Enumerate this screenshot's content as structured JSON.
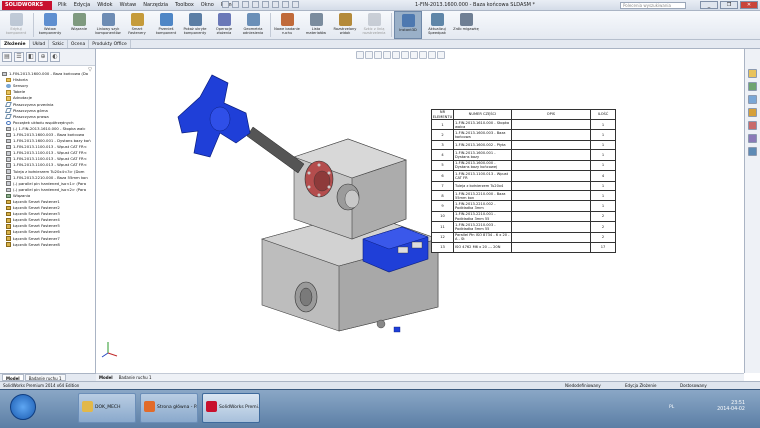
{
  "app": {
    "logo_text": "SOLIDWORKS",
    "menus": [
      "Plik",
      "Edycja",
      "Widok",
      "Wstaw",
      "Narzędzia",
      "Toolbox",
      "Okno",
      "Pomoc"
    ],
    "doc_title": "1-FIN-2013.1600.000 - Baza końcowa SLDASM *",
    "search_placeholder": "Polecenia wyszukiwania",
    "window_controls": [
      "_",
      "❐",
      "✕"
    ]
  },
  "ribbon": {
    "buttons": [
      {
        "label": "Edytuj komponent",
        "icon": "edit-component-icon",
        "color": "#8c9db3",
        "disabled": true
      },
      {
        "label": "Wstaw komponenty",
        "icon": "insert-components-icon",
        "color": "#5f8fd0",
        "disabled": false
      },
      {
        "label": "Wiązanie",
        "icon": "mate-icon",
        "color": "#7f9a7f",
        "disabled": false
      },
      {
        "label": "Liniowy szyk komponentów",
        "icon": "linear-pattern-icon",
        "color": "#6d8cb4",
        "disabled": false
      },
      {
        "label": "Smart Fastenery",
        "icon": "smart-fasteners-icon",
        "color": "#c59b3b",
        "disabled": false
      },
      {
        "label": "Przenieś komponent",
        "icon": "move-component-icon",
        "color": "#4e86c6",
        "disabled": false
      },
      {
        "label": "Pokaż ukryte komponenty",
        "icon": "show-hidden-icon",
        "color": "#5b7ea5",
        "disabled": false
      },
      {
        "label": "Operacje złożenia",
        "icon": "assembly-features-icon",
        "color": "#6a78b8",
        "disabled": false
      },
      {
        "label": "Geometria odniesienia",
        "icon": "reference-geometry-icon",
        "color": "#6a8fb8",
        "disabled": false
      },
      {
        "label": "Nowe badanie ruchu",
        "icon": "motion-study-icon",
        "color": "#c06a3a",
        "disabled": false
      },
      {
        "label": "Lista materiałów",
        "icon": "bom-icon",
        "color": "#7b8c9e",
        "disabled": false
      },
      {
        "label": "Rozstrzelony widok",
        "icon": "exploded-view-icon",
        "color": "#b48a3a",
        "disabled": false
      },
      {
        "label": "Szkic z linią rozstrzelenia",
        "icon": "explode-line-icon",
        "color": "#a0a8b3",
        "disabled": true
      },
      {
        "label": "Instant3D",
        "icon": "instant3d-icon",
        "color": "#4d78b0",
        "disabled": false,
        "active": true
      },
      {
        "label": "Aktualizuj Speedpak",
        "icon": "speedpak-icon",
        "color": "#5f86a8",
        "disabled": false
      },
      {
        "label": "Zrób migawkę",
        "icon": "snapshot-icon",
        "color": "#6f7f94",
        "disabled": false
      }
    ]
  },
  "command_tabs": [
    "Złożenie",
    "Układ",
    "Szkic",
    "Ocena",
    "Produkty Office"
  ],
  "feature_tree": {
    "filter_icon": "▽",
    "items": [
      {
        "label": "1-FIN-2013.1600.000 - Baza końcowa  (Do",
        "icon": "part",
        "indent": 0
      },
      {
        "label": "Historia",
        "icon": "folder",
        "indent": 1
      },
      {
        "label": "Sensory",
        "icon": "sensor",
        "indent": 1
      },
      {
        "label": "Tabele",
        "icon": "folder",
        "indent": 1
      },
      {
        "label": "Adnotacje",
        "icon": "folder",
        "indent": 1
      },
      {
        "label": "Płaszczyzna przednia",
        "icon": "plane",
        "indent": 1
      },
      {
        "label": "Płaszczyzna górna",
        "icon": "plane",
        "indent": 1
      },
      {
        "label": "Płaszczyzna prawa",
        "icon": "plane",
        "indent": 1
      },
      {
        "label": "Początek układu współrzędnych",
        "icon": "origin",
        "indent": 1
      },
      {
        "label": "(-) 1-FIN-2013.1610.000 - Stopka walc",
        "icon": "part",
        "indent": 1
      },
      {
        "label": "1-FIN-2013.1600.003 - Baza końcowa",
        "icon": "part",
        "indent": 1
      },
      {
        "label": "1-FIN-2013.1600.001 - Dystans bazy koń",
        "icon": "part",
        "indent": 1
      },
      {
        "label": "1-FIN-2013.1100.013 - Wpust CAT FR<",
        "icon": "part",
        "indent": 1
      },
      {
        "label": "1-FIN-2013.1100.013 - Wpust CAT FR<",
        "icon": "part",
        "indent": 1
      },
      {
        "label": "1-FIN-2013.1100.013 - Wpust CAT FR<",
        "icon": "part",
        "indent": 1
      },
      {
        "label": "1-FIN-2013.1100.013 - Wpust CAT FR<",
        "icon": "part",
        "indent": 1
      },
      {
        "label": "Tuleja z kołnierzem Tu20x4<3> (Dom",
        "icon": "part",
        "indent": 1
      },
      {
        "label": "1-FIN-2013.2210.000 - Baza 55mm kon",
        "icon": "part",
        "indent": 1
      },
      {
        "label": "(-) parallel pin hardened_iso<1> (Para",
        "icon": "part",
        "indent": 1
      },
      {
        "label": "(-) parallel pin hardened_iso<2> (Para",
        "icon": "part",
        "indent": 1
      },
      {
        "label": "Wiązania",
        "icon": "mate",
        "indent": 1
      },
      {
        "label": "Łącznik Smart Fastener1",
        "icon": "fastener",
        "indent": 1
      },
      {
        "label": "Łącznik Smart Fastener2",
        "icon": "fastener",
        "indent": 1
      },
      {
        "label": "Łącznik Smart Fastener3",
        "icon": "fastener",
        "indent": 1
      },
      {
        "label": "Łącznik Smart Fastener4",
        "icon": "fastener",
        "indent": 1
      },
      {
        "label": "Łącznik Smart Fastener5",
        "icon": "fastener",
        "indent": 1
      },
      {
        "label": "Łącznik Smart Fastener6",
        "icon": "fastener",
        "indent": 1
      },
      {
        "label": "Łącznik Smart Fastener7",
        "icon": "fastener",
        "indent": 1
      },
      {
        "label": "Łącznik Smart Fastener8",
        "icon": "fastener",
        "indent": 1
      }
    ]
  },
  "bom": {
    "headers": [
      "NR ELEMENTU",
      "NUMER CZĘŚCI",
      "OPIS",
      "ILOŚĆ"
    ],
    "rows": [
      {
        "nr": "1",
        "part": "1-FIN-2013.1610.000 - Stopka walca",
        "desc": "",
        "qty": "1"
      },
      {
        "nr": "2",
        "part": "1-FIN-2013.1600.003 - Baza końcowa",
        "desc": "",
        "qty": "1"
      },
      {
        "nr": "3",
        "part": "1-FIN-2013.1600.002 - Płyta",
        "desc": "",
        "qty": "1"
      },
      {
        "nr": "4",
        "part": "1-FIN-2013.1600.001 - Dystans bazy",
        "desc": "",
        "qty": "1"
      },
      {
        "nr": "5",
        "part": "1-FIN-2013.1600.000 - Dystans bazy końcowej",
        "desc": "",
        "qty": "1"
      },
      {
        "nr": "6",
        "part": "1-FIN-2013.1100.013 - Wpust CAT FR",
        "desc": "",
        "qty": "4"
      },
      {
        "nr": "7",
        "part": "Tuleja z kołnierzem Tu20x4",
        "desc": "",
        "qty": "1"
      },
      {
        "nr": "8",
        "part": "1-FIN-2013.2210.000 - Baza 55mm kon",
        "desc": "",
        "qty": "1"
      },
      {
        "nr": "9",
        "part": "1-FIN-2013.2210.002 - Podkładka 3mm",
        "desc": "",
        "qty": "1"
      },
      {
        "nr": "10",
        "part": "1-FIN-2013.2210.001 - Podkładka 3mm 55",
        "desc": "",
        "qty": "2"
      },
      {
        "nr": "11",
        "part": "1-FIN-2013.2210.003 - Podkładka 5mm 55",
        "desc": "",
        "qty": "2"
      },
      {
        "nr": "12",
        "part": "Parallel Pin ISO 8734 - 6 x 20 - A - St",
        "desc": "",
        "qty": "2"
      },
      {
        "nr": "13",
        "part": "ISO 4762 M6 x 20 --- 20N",
        "desc": "",
        "qty": "17"
      }
    ]
  },
  "bottom_tabs": [
    "Model",
    "Badanie ruchu 1"
  ],
  "model_tabs": [
    "Model",
    "Badanie ruchu 1"
  ],
  "status": {
    "app": "SolidWorks Premium 2014 x64 Edition",
    "mode": "Niedodefiniowany",
    "edit": "Edycja Złożenie",
    "custom": "Dostosowany"
  },
  "taskbar": {
    "buttons": [
      {
        "label": "DOK_MECH",
        "color": "#e2b84a",
        "active": false
      },
      {
        "label": "Strona główna - P...",
        "color": "#e26b2a",
        "active": false
      },
      {
        "label": "SolidWorks Premi...",
        "color": "#c8102e",
        "active": true
      }
    ],
    "lang": "PL",
    "time": "23:51",
    "date": "2014-04-02"
  },
  "colors": {
    "accent_blue": "#1f3fd8",
    "part_gray": "#c6c6c6",
    "flange_red": "#b44d4d"
  }
}
